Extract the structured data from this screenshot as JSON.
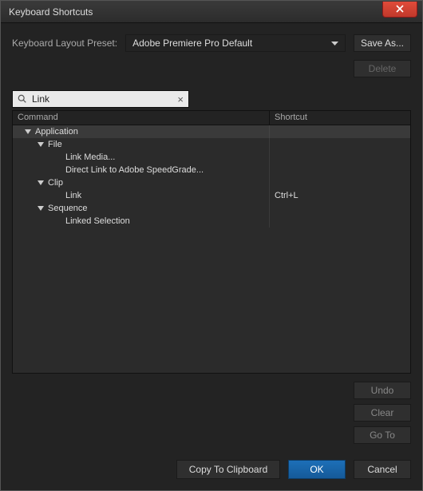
{
  "window": {
    "title": "Keyboard Shortcuts"
  },
  "preset": {
    "label": "Keyboard Layout Preset:",
    "value": "Adobe Premiere Pro Default",
    "save_as": "Save As...",
    "delete": "Delete"
  },
  "search": {
    "value": "Link",
    "placeholder": "",
    "clear_label": "×"
  },
  "table": {
    "headers": {
      "command": "Command",
      "shortcut": "Shortcut"
    },
    "rows": [
      {
        "label": "Application",
        "indent": 0,
        "expander": true,
        "section": true,
        "shortcut": ""
      },
      {
        "label": "File",
        "indent": 1,
        "expander": true,
        "section": false,
        "shortcut": ""
      },
      {
        "label": "Link Media...",
        "indent": 3,
        "expander": false,
        "section": false,
        "shortcut": ""
      },
      {
        "label": "Direct Link to Adobe SpeedGrade...",
        "indent": 3,
        "expander": false,
        "section": false,
        "shortcut": ""
      },
      {
        "label": "Clip",
        "indent": 1,
        "expander": true,
        "section": false,
        "shortcut": ""
      },
      {
        "label": "Link",
        "indent": 3,
        "expander": false,
        "section": false,
        "shortcut": "Ctrl+L"
      },
      {
        "label": "Sequence",
        "indent": 1,
        "expander": true,
        "section": false,
        "shortcut": ""
      },
      {
        "label": "Linked Selection",
        "indent": 3,
        "expander": false,
        "section": false,
        "shortcut": ""
      }
    ]
  },
  "side_buttons": {
    "undo": "Undo",
    "clear": "Clear",
    "goto": "Go To"
  },
  "bottom": {
    "copy": "Copy To Clipboard",
    "ok": "OK",
    "cancel": "Cancel"
  }
}
